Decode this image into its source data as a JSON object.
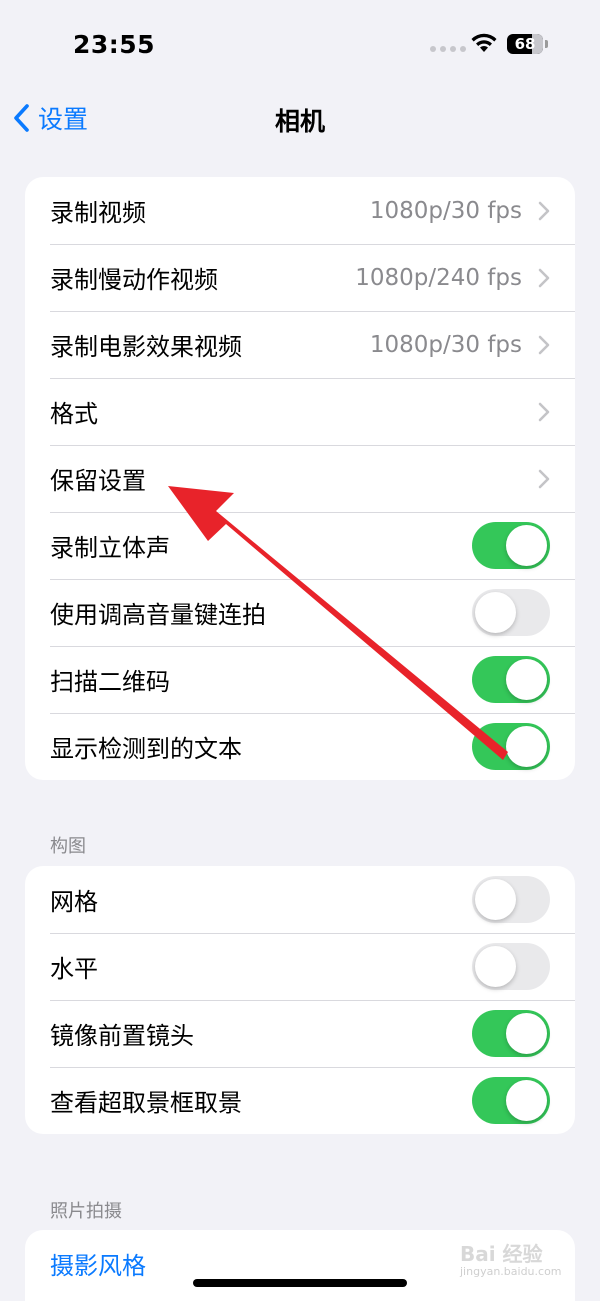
{
  "status": {
    "time": "23:55",
    "battery": "68"
  },
  "nav": {
    "back_label": "设置",
    "title": "相机"
  },
  "main_group": [
    {
      "label": "录制视频",
      "value": "1080p/30 fps",
      "type": "link"
    },
    {
      "label": "录制慢动作视频",
      "value": "1080p/240 fps",
      "type": "link"
    },
    {
      "label": "录制电影效果视频",
      "value": "1080p/30 fps",
      "type": "link"
    },
    {
      "label": "格式",
      "value": "",
      "type": "link"
    },
    {
      "label": "保留设置",
      "value": "",
      "type": "link"
    },
    {
      "label": "录制立体声",
      "type": "toggle",
      "on": true
    },
    {
      "label": "使用调高音量键连拍",
      "type": "toggle",
      "on": false
    },
    {
      "label": "扫描二维码",
      "type": "toggle",
      "on": true
    },
    {
      "label": "显示检测到的文本",
      "type": "toggle",
      "on": true
    }
  ],
  "composition": {
    "header": "构图",
    "rows": [
      {
        "label": "网格",
        "on": false
      },
      {
        "label": "水平",
        "on": false
      },
      {
        "label": "镜像前置镜头",
        "on": true
      },
      {
        "label": "查看超取景框取景",
        "on": true
      }
    ]
  },
  "photo": {
    "header": "照片拍摄",
    "style_label": "摄影风格"
  },
  "watermark": {
    "brand": "Bai 经验",
    "url": "jingyan.baidu.com"
  },
  "colors": {
    "accent": "#0a7aff",
    "toggle_on": "#34c759",
    "annotation_arrow": "#e8232a"
  }
}
